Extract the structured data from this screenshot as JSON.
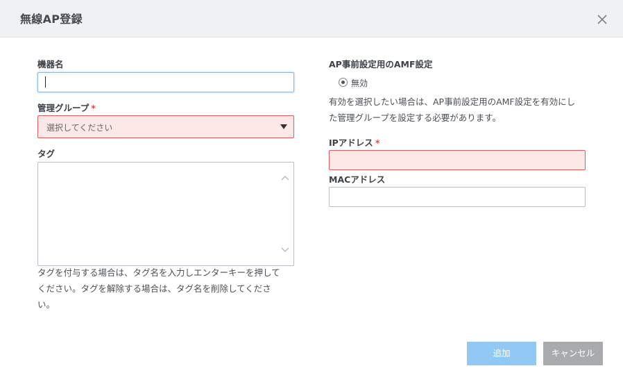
{
  "dialog": {
    "title": "無線AP登録"
  },
  "form": {
    "device_name": {
      "label": "機器名",
      "value": ""
    },
    "management_group": {
      "label": "管理グループ",
      "required_mark": "*",
      "placeholder": "選択してください"
    },
    "tags": {
      "label": "タグ",
      "help_line1": "タグを付与する場合は、タグ名を入力しエンターキーを押して",
      "help_line2": "ください。タグを解除する場合は、タグ名を削除してくださ",
      "help_line3": "い。"
    },
    "amf": {
      "label": "AP事前設定用のAMF設定",
      "option_label": "無効",
      "help_line1": "有効を選択したい場合は、AP事前設定用のAMF設定を有効にし",
      "help_line2": "た管理グループを設定する必要があります。"
    },
    "ip_address": {
      "label": "IPアドレス",
      "required_mark": "*",
      "value": ""
    },
    "mac_address": {
      "label": "MACアドレス",
      "value": ""
    }
  },
  "footer": {
    "add_label": "追加",
    "cancel_label": "キャンセル"
  },
  "colors": {
    "header_bg": "#f0f1f3",
    "error_border": "#e05a5e",
    "error_bg": "#fde8e8",
    "primary_button": "#92c8f4",
    "secondary_button": "#a8aaad",
    "required": "#e0474c"
  },
  "icons": {
    "close": "close-icon",
    "dropdown": "triangle-down-icon",
    "scroll_up": "chevron-up-icon",
    "scroll_down": "chevron-down-icon"
  }
}
